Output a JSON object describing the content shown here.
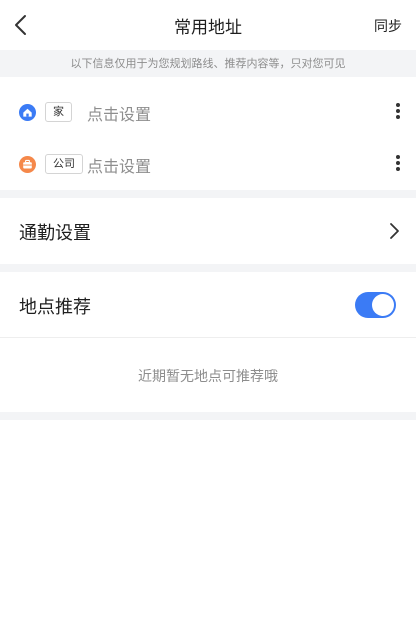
{
  "header": {
    "title": "常用地址",
    "sync_label": "同步"
  },
  "notice": "以下信息仅用于为您规划路线、推荐内容等，只对您可见",
  "addresses": [
    {
      "tag": "家",
      "action": "点击设置",
      "icon": "home-icon",
      "color": "#3b7bf5"
    },
    {
      "tag": "公司",
      "action": "点击设置",
      "icon": "briefcase-icon",
      "color": "#f5884a"
    }
  ],
  "commute": {
    "label": "通勤设置"
  },
  "recommendation": {
    "label": "地点推荐",
    "enabled": true,
    "empty_text": "近期暂无地点可推荐哦"
  },
  "colors": {
    "accent": "#3b7bf5",
    "work_icon": "#f5884a",
    "background": "#f3f4f6"
  }
}
